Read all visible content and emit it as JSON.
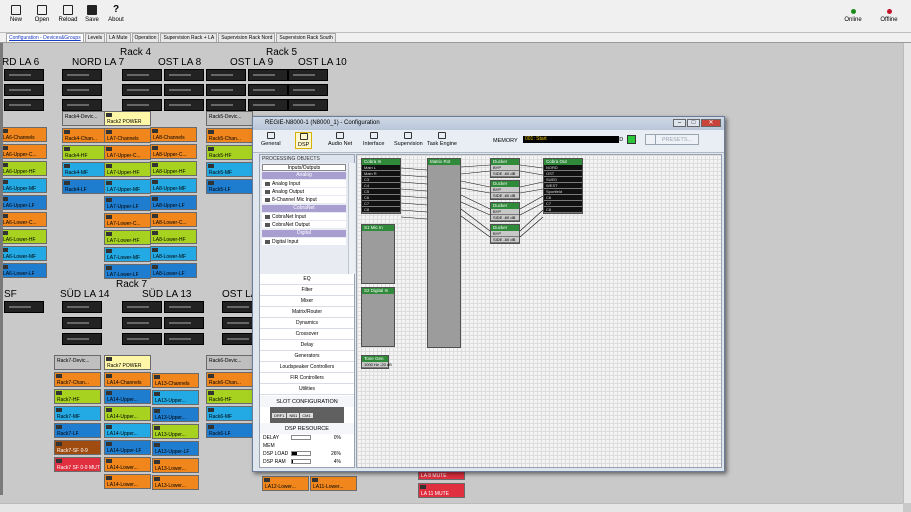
{
  "toolbar": {
    "new": "New",
    "open": "Open",
    "reload": "Reload",
    "save": "Save",
    "about": "About"
  },
  "status": {
    "online": "Online",
    "offline": "Offline",
    "online_color": "#1a8a1a",
    "offline_color": "#c0142a"
  },
  "tabs": [
    "Configuration - Devices&Groups",
    "Levels",
    "LA Mute",
    "Operation",
    "Supervision Rack + LA",
    "Supervision Rack Nord",
    "Supervision Rack South"
  ],
  "canvas": {
    "rack_labels": [
      "Rack 4",
      "Rack 5",
      "Rack 7"
    ],
    "top_labels": [
      "RD LA 6",
      "NORD LA 7",
      "OST LA 8",
      "OST LA 9",
      "OST LA 10"
    ],
    "mid_labels": [
      "SF",
      "SÜD LA 14",
      "SÜD LA 13",
      "OST LA"
    ],
    "top_cols": [
      [
        "LA6-Channels",
        "LA6-Upper-C...",
        "LA6-Upper-HF",
        "LA6-Upper-MF",
        "LA6-Upper-LF",
        "LA6-Lower-C...",
        "LA6-Lower-HF",
        "LA6-Lower-MF",
        "LA6-Lower-LF"
      ],
      [
        "Rack4-Devic...",
        "Rack4-Chan...",
        "Rack4-HF",
        "Rack4-MF",
        "Rack4-LF"
      ],
      [
        "Rack2 POWER",
        "LA7-Channels",
        "LA7-Upper-C...",
        "LA7-Upper-HF",
        "LA7-Upper-MF",
        "LA7-Upper-LF",
        "LA7-Lower-C...",
        "LA7-Lower-HF",
        "LA7-Lower-MF",
        "LA7-Lower-LF"
      ],
      [
        "LA8-Channels",
        "LA8-Upper-C...",
        "LA8-Upper-HF",
        "LA8-Upper-MF",
        "LA8-Upper-LF",
        "LA8-Lower-C...",
        "LA8-Lower-HF",
        "LA8-Lower-MF",
        "LA8-Lower-LF"
      ],
      [
        "Rack5-Devic...",
        "Rack5-Chan...",
        "Rack5-HF",
        "Rack5-MF",
        "Rack5-LF"
      ]
    ],
    "bottom_cols": [
      [
        "Rack7-Devic...",
        "Rack7-Chan...",
        "Rack7-HF",
        "Rack7-MF",
        "Rack7-LF",
        "Rack7-SF 0-9",
        "Rack7 SF 0-9 MUTE"
      ],
      [
        "Rack7 POWER",
        "LA14-Channels",
        "LA14-Upper...",
        "LA14-Upper...",
        "LA14-Upper...",
        "LA14-Upper-LF",
        "LA14-Lower...",
        "LA14-Lower..."
      ],
      [
        "LA13-Channels",
        "LA13-Upper...",
        "LA13-Upper...",
        "LA13-Upper...",
        "LA13-Upper-LF",
        "LA13-Lower...",
        "LA13-Lower..."
      ],
      [
        "Rack6-Devic...",
        "Rack6-Chan...",
        "Rack6-HF",
        "Rack6-MF",
        "Rack6-LF"
      ]
    ],
    "bottom_extra": [
      "LA12-Lower...",
      "LA11-Lower...",
      "LA 8 MUTE",
      "LA 11 MUTE"
    ]
  },
  "window": {
    "title": "REGIE-N8000-1 (N8000_1) - Configuration",
    "toolbar": [
      "General",
      "DSP",
      "Audio Net",
      "Interface",
      "Supervision",
      "Task Engine"
    ],
    "memory_label": "MEMORY",
    "memory_value": "001: Start",
    "edited_label": "EDITED",
    "store": "STORE",
    "presets": "PRESETS...",
    "processing_header": "PROCESSING OBJECTS",
    "groups": [
      {
        "name": "Inputs/Outputs",
        "selected": true,
        "items": []
      },
      {
        "name": "Analog",
        "items": [
          "Analog Input",
          "Analog Output",
          "8-Channel Mic Input"
        ]
      },
      {
        "name": "CobraNet",
        "items": [
          "CobraNet Input",
          "CobraNet Output"
        ]
      },
      {
        "name": "Digital",
        "items": [
          "Digital Input"
        ]
      }
    ],
    "categories": [
      "EQ",
      "Filter",
      "Mixer",
      "Matrix/Router",
      "Dynamics",
      "Crossover",
      "Delay",
      "Generators",
      "Loudspeaker Controllers",
      "FIR Controllers",
      "Utilities"
    ],
    "slot_title": "SLOT CONFIGURATION",
    "slot_items": [
      "DRF1",
      "NB1",
      "CM1"
    ],
    "dsp_title": "DSP RESOURCE",
    "resources": [
      {
        "name": "DELAY MEM",
        "value": "0%",
        "level": 0
      },
      {
        "name": "DSP LOAD",
        "value": "26%",
        "level": 26
      },
      {
        "name": "DSP RAM",
        "value": "4%",
        "level": 4
      }
    ],
    "blocks": {
      "cobra_in": "Cobra In",
      "cobra_in_rows": [
        "Main L",
        "Main R",
        "C3",
        "C4",
        "C5",
        "C6",
        "C7",
        "C8"
      ],
      "matrix": "Matrix Rot",
      "ducker": "Ducker",
      "ducker_rows": [
        "BYP",
        "SIDE -60 dB"
      ],
      "cobra_out": "Cobra Out",
      "cobra_out_rows": [
        "NORD",
        "OST",
        "SUED",
        "WEST",
        "Sportfeld",
        "C6",
        "C7",
        "C8"
      ],
      "s1": "S1 Mic In",
      "s2": "S2 Digital In",
      "tone": "Tone Gen",
      "tone_row": "1000 Hz  -20 dB"
    }
  }
}
